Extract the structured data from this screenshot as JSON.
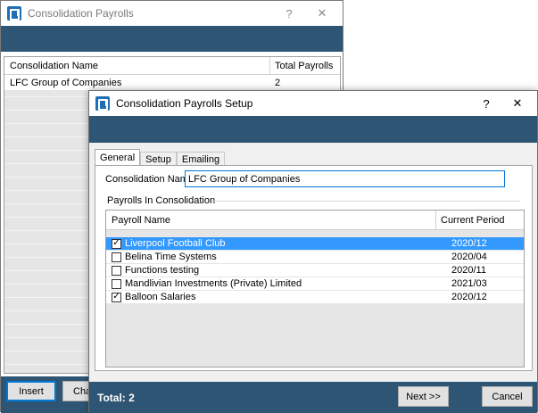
{
  "back_window": {
    "title": "Consolidation Payrolls",
    "help_symbol": "?",
    "close_symbol": "✕",
    "columns": [
      "Consolidation Name",
      "Total Payrolls"
    ],
    "rows": [
      {
        "name": "LFC Group of Companies",
        "total": "2"
      }
    ],
    "buttons": {
      "insert": "Insert",
      "change": "Cha"
    }
  },
  "front_window": {
    "title": "Consolidation Payrolls Setup",
    "help_symbol": "?",
    "close_symbol": "✕",
    "tabs": [
      "General",
      "Setup",
      "Emailing"
    ],
    "active_tab": "General",
    "consolidation_name_label": "Consolidation Name:",
    "consolidation_name_value": "LFC Group of Companies",
    "group_label": "Payrolls In Consolidation",
    "columns": [
      "Payroll Name",
      "Current Period"
    ],
    "payrolls": [
      {
        "name": "Liverpool Football Club",
        "period": "2020/12",
        "checked": true,
        "selected": true
      },
      {
        "name": "Belina Time Systems",
        "period": "2020/04",
        "checked": false,
        "selected": false
      },
      {
        "name": "Functions testing",
        "period": "2020/11",
        "checked": false,
        "selected": false
      },
      {
        "name": "Mandlivian Investments (Private) Limited",
        "period": "2021/03",
        "checked": false,
        "selected": false
      },
      {
        "name": "Balloon Salaries",
        "period": "2020/12",
        "checked": true,
        "selected": false
      }
    ],
    "footer": {
      "total": "Total:  2",
      "next": "Next >>",
      "cancel": "Cancel"
    }
  },
  "colors": {
    "band": "#2e5573",
    "selection": "#3399ff",
    "focus": "#0078d7"
  }
}
